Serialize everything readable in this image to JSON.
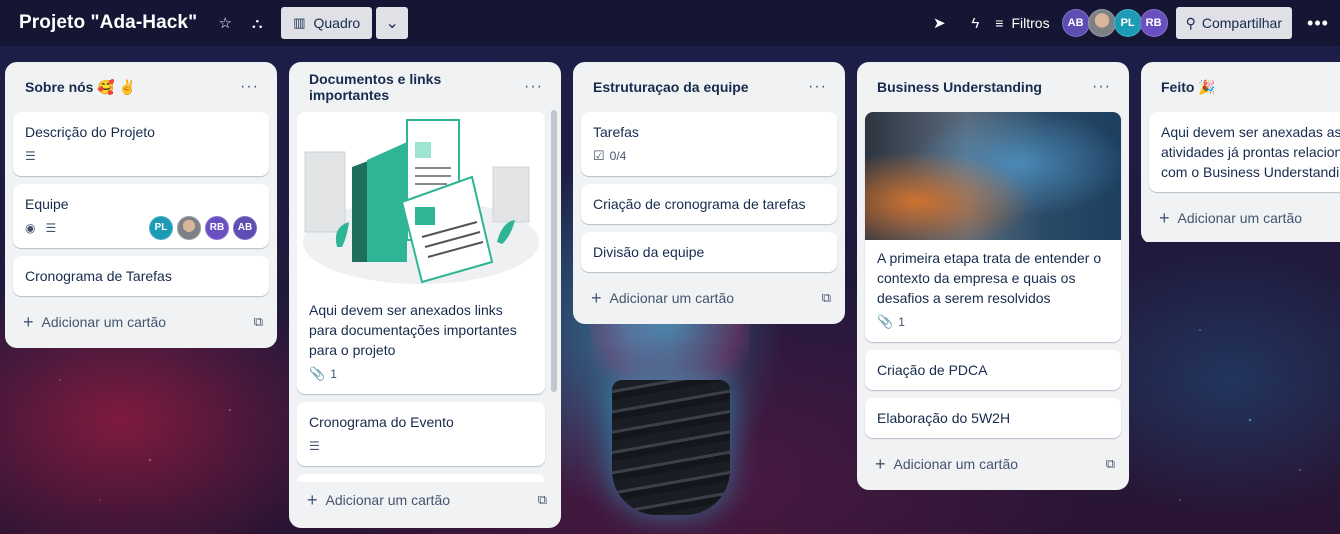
{
  "header": {
    "board_title": "Projeto \"Ada-Hack\"",
    "view_label": "Quadro",
    "filters_label": "Filtros",
    "members": [
      "AB",
      "PL",
      "RB"
    ],
    "share_label": "Compartilhar"
  },
  "lists": [
    {
      "title": "Sobre nós 🥰 ✌️",
      "cards": [
        {
          "title": "Descrição do Projeto"
        },
        {
          "title": "Equipe",
          "members": [
            "PL",
            "RB",
            "AB"
          ]
        },
        {
          "title": "Cronograma de Tarefas"
        }
      ],
      "add_label": "Adicionar um cartão"
    },
    {
      "title": "Documentos e links importantes",
      "cards": [
        {
          "title": "Aqui devem ser anexados links para documentações importantes para o projeto",
          "attachments": "1"
        },
        {
          "title": "Cronograma do Evento"
        }
      ],
      "add_label": "Adicionar um cartão"
    },
    {
      "title": "Estruturaçao da equipe",
      "cards": [
        {
          "title": "Tarefas",
          "checklist": "0/4"
        },
        {
          "title": "Criação de cronograma de tarefas"
        },
        {
          "title": "Divisão da equipe"
        }
      ],
      "add_label": "Adicionar um cartão"
    },
    {
      "title": "Business Understanding",
      "cards": [
        {
          "title": "A primeira etapa trata de entender o contexto da empresa e quais os desafios a serem resolvidos",
          "attachments": "1"
        },
        {
          "title": "Criação de PDCA"
        },
        {
          "title": "Elaboração do 5W2H"
        }
      ],
      "add_label": "Adicionar um cartão"
    },
    {
      "title": "Feito 🎉",
      "cards": [
        {
          "title": "Aqui devem ser anexadas as atividades já prontas relacionadas com o Business Understanding"
        }
      ],
      "add_label": "Adicionar um cartão"
    }
  ]
}
